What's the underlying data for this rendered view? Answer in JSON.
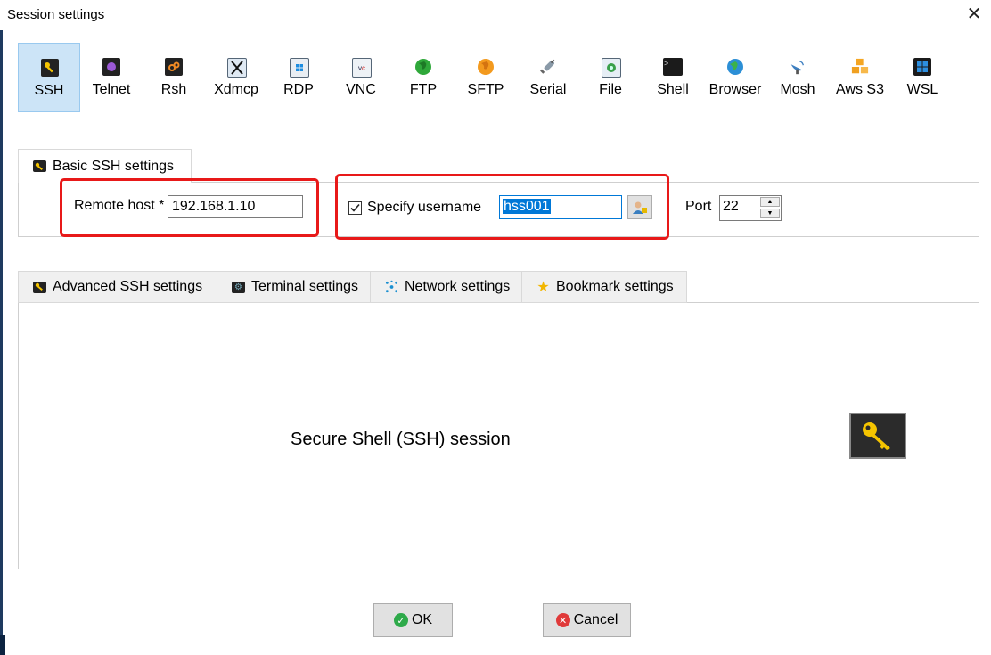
{
  "window": {
    "title": "Session settings",
    "close_glyph": "✕"
  },
  "toolbar": {
    "items": [
      {
        "label": "SSH",
        "icon": "ssh-key-icon",
        "selected": true
      },
      {
        "label": "Telnet",
        "icon": "telnet-icon"
      },
      {
        "label": "Rsh",
        "icon": "rsh-icon"
      },
      {
        "label": "Xdmcp",
        "icon": "xdmcp-icon"
      },
      {
        "label": "RDP",
        "icon": "rdp-monitor-icon"
      },
      {
        "label": "VNC",
        "icon": "vnc-monitor-icon"
      },
      {
        "label": "FTP",
        "icon": "ftp-globe-icon"
      },
      {
        "label": "SFTP",
        "icon": "sftp-globe-icon"
      },
      {
        "label": "Serial",
        "icon": "serial-plug-icon"
      },
      {
        "label": "File",
        "icon": "file-monitor-icon"
      },
      {
        "label": "Shell",
        "icon": "terminal-icon"
      },
      {
        "label": "Browser",
        "icon": "browser-globe-icon"
      },
      {
        "label": "Mosh",
        "icon": "satellite-dish-icon"
      },
      {
        "label": "Aws S3",
        "icon": "aws-cubes-icon"
      },
      {
        "label": "WSL",
        "icon": "windows-logo-icon"
      }
    ]
  },
  "basic": {
    "tab_label": "Basic SSH settings",
    "remote_host_label": "Remote host *",
    "remote_host_value": "192.168.1.10",
    "specify_username_label": "Specify username",
    "specify_username_checked": true,
    "username_value": "hss001",
    "port_label": "Port",
    "port_value": "22"
  },
  "lower_tabs": [
    {
      "label": "Advanced SSH settings",
      "icon": "key-icon"
    },
    {
      "label": "Terminal settings",
      "icon": "terminal-settings-icon"
    },
    {
      "label": "Network settings",
      "icon": "network-icon"
    },
    {
      "label": "Bookmark settings",
      "icon": "star-icon"
    }
  ],
  "description": "Secure Shell (SSH) session",
  "buttons": {
    "ok": "OK",
    "cancel": "Cancel"
  },
  "colors": {
    "selection": "#cce4f7",
    "highlight_box": "#e81919",
    "ok_icon": "#2eaa4a",
    "cancel_icon": "#e03a3a"
  }
}
